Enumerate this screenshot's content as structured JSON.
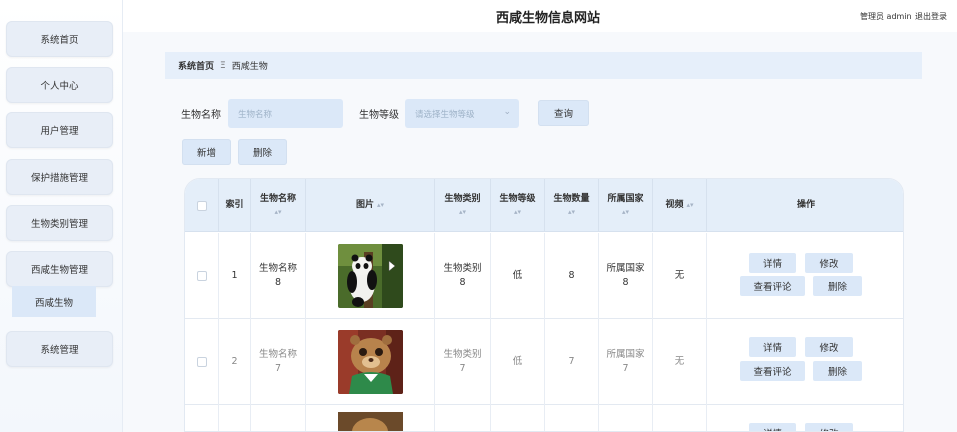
{
  "header": {
    "site_title": "西咸生物信息网站",
    "admin_label": "管理员 admin",
    "logout": "退出登录"
  },
  "sidebar": {
    "items": [
      {
        "label": "系统首页"
      },
      {
        "label": "个人中心"
      },
      {
        "label": "用户管理"
      },
      {
        "label": "保护措施管理"
      },
      {
        "label": "生物类别管理"
      },
      {
        "label": "西咸生物管理"
      },
      {
        "label": "系统管理"
      }
    ],
    "sub_item": "西咸生物"
  },
  "breadcrumb": {
    "home": "系统首页",
    "separator": "Ξ",
    "current": "西咸生物"
  },
  "search": {
    "name_label": "生物名称",
    "name_placeholder": "生物名称",
    "level_label": "生物等级",
    "level_placeholder": "请选择生物等级",
    "query_button": "查询"
  },
  "actions": {
    "add": "新增",
    "delete": "删除"
  },
  "table": {
    "headers": {
      "index": "索引",
      "name": "生物名称",
      "image": "图片",
      "category": "生物类别",
      "level": "生物等级",
      "quantity": "生物数量",
      "country": "所属国家",
      "video": "视频",
      "operation": "操作"
    },
    "rows": [
      {
        "index": "1",
        "name": "生物名称",
        "name_no": "8",
        "category": "生物类别",
        "category_no": "8",
        "level": "低",
        "quantity": "8",
        "country": "所属国家",
        "country_no": "8",
        "video": "无",
        "image_icon": "panda-photo"
      },
      {
        "index": "2",
        "name": "生物名称",
        "name_no": "7",
        "category": "生物类别",
        "category_no": "7",
        "level": "低",
        "quantity": "7",
        "country": "所属国家",
        "country_no": "7",
        "video": "无",
        "image_icon": "chipmunk-photo"
      }
    ],
    "row_buttons": {
      "detail": "详情",
      "edit": "修改",
      "comments": "查看评论",
      "delete": "删除"
    }
  },
  "colors": {
    "accent": "#dbe8f8",
    "header_bg": "#e4eef9"
  }
}
